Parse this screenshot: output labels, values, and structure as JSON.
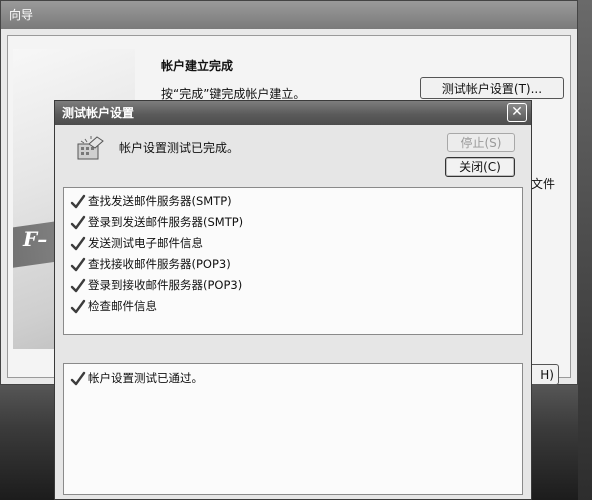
{
  "wizard": {
    "title": "向导",
    "heading": "帐户建立完成",
    "description": "按“完成”键完成帐户建立。",
    "test_button": "测试帐户设置(T)...",
    "side_text": "文件",
    "next_button_fragment": "H)",
    "banner_text": "F–"
  },
  "dialog": {
    "title": "测试帐户设置",
    "close_glyph": "✕",
    "status": "帐户设置测试已完成。",
    "stop_button": "停止(S)",
    "close_button": "关闭(C)",
    "tasks": [
      {
        "label": "查找发送邮件服务器(SMTP)",
        "done": true
      },
      {
        "label": "登录到发送邮件服务器(SMTP)",
        "done": true
      },
      {
        "label": "发送测试电子邮件信息",
        "done": true
      },
      {
        "label": "查找接收邮件服务器(POP3)",
        "done": true
      },
      {
        "label": "登录到接收邮件服务器(POP3)",
        "done": true
      },
      {
        "label": "检查邮件信息",
        "done": true
      }
    ],
    "results": [
      {
        "label": "帐户设置测试已通过。",
        "done": true
      }
    ]
  }
}
